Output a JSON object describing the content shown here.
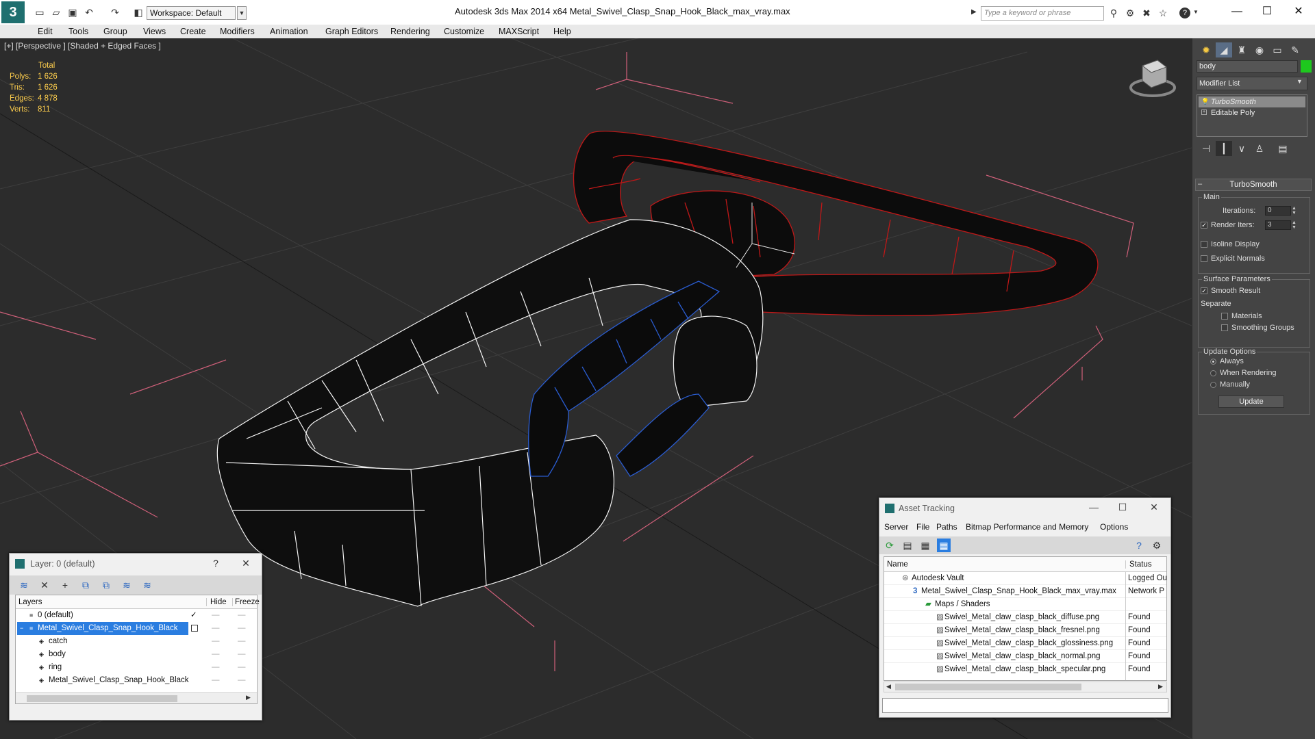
{
  "app": {
    "logo_text": "3",
    "workspace": "Workspace: Default",
    "window_title": "Autodesk 3ds Max  2014 x64      Metal_Swivel_Clasp_Snap_Hook_Black_max_vray.max",
    "search_placeholder": "Type a keyword or phrase"
  },
  "menu": [
    "Edit",
    "Tools",
    "Group",
    "Views",
    "Create",
    "Modifiers",
    "Animation",
    "Graph Editors",
    "Rendering",
    "Customize",
    "MAXScript",
    "Help"
  ],
  "viewport": {
    "label": "[+] [Perspective ] [Shaded + Edged Faces ]",
    "stats_header": "Total",
    "stats": [
      {
        "label": "Polys:",
        "value": "1 626"
      },
      {
        "label": "Tris:",
        "value": "1 626"
      },
      {
        "label": "Edges:",
        "value": "4 878"
      },
      {
        "label": "Verts:",
        "value": "811"
      }
    ]
  },
  "command_panel": {
    "object_name": "body",
    "object_color": "#1ec81e",
    "modifier_list": "Modifier List",
    "stack": [
      "TurboSmooth",
      "Editable Poly"
    ],
    "rollout_title": "TurboSmooth",
    "main_group": "Main",
    "iterations_label": "Iterations:",
    "iterations_value": "0",
    "render_iters_label": "Render Iters:",
    "render_iters_value": "3",
    "isoline_display": "Isoline Display",
    "explicit_normals": "Explicit Normals",
    "surface_params_group": "Surface Parameters",
    "smooth_result": "Smooth Result",
    "separate_label": "Separate",
    "materials": "Materials",
    "smoothing_groups": "Smoothing Groups",
    "update_options_group": "Update Options",
    "always": "Always",
    "when_rendering": "When Rendering",
    "manually": "Manually",
    "update_button": "Update"
  },
  "layer_window": {
    "title": "Layer: 0 (default)",
    "help": "?",
    "col_layers": "Layers",
    "col_hide": "Hide",
    "col_freeze": "Freeze",
    "rows": [
      {
        "name": "0 (default)",
        "indent": 0,
        "selected": false
      },
      {
        "name": "Metal_Swivel_Clasp_Snap_Hook_Black",
        "indent": 0,
        "selected": true
      },
      {
        "name": "catch",
        "indent": 1,
        "selected": false
      },
      {
        "name": "body",
        "indent": 1,
        "selected": false
      },
      {
        "name": "ring",
        "indent": 1,
        "selected": false
      },
      {
        "name": "Metal_Swivel_Clasp_Snap_Hook_Black",
        "indent": 1,
        "selected": false
      }
    ]
  },
  "asset_window": {
    "title": "Asset Tracking",
    "menu": [
      "Server",
      "File",
      "Paths",
      "Bitmap Performance and Memory",
      "Options"
    ],
    "col_name": "Name",
    "col_status": "Status",
    "rows": [
      {
        "name": "Autodesk Vault",
        "status": "Logged Ou",
        "indent": 0
      },
      {
        "name": "Metal_Swivel_Clasp_Snap_Hook_Black_max_vray.max",
        "status": "Network P",
        "indent": 1
      },
      {
        "name": "Maps / Shaders",
        "status": "",
        "indent": 2
      },
      {
        "name": "Swivel_Metal_claw_clasp_black_diffuse.png",
        "status": "Found",
        "indent": 3
      },
      {
        "name": "Swivel_Metal_claw_clasp_black_fresnel.png",
        "status": "Found",
        "indent": 3
      },
      {
        "name": "Swivel_Metal_claw_clasp_black_glossiness.png",
        "status": "Found",
        "indent": 3
      },
      {
        "name": "Swivel_Metal_claw_clasp_black_normal.png",
        "status": "Found",
        "indent": 3
      },
      {
        "name": "Swivel_Metal_claw_clasp_black_specular.png",
        "status": "Found",
        "indent": 3
      }
    ]
  }
}
